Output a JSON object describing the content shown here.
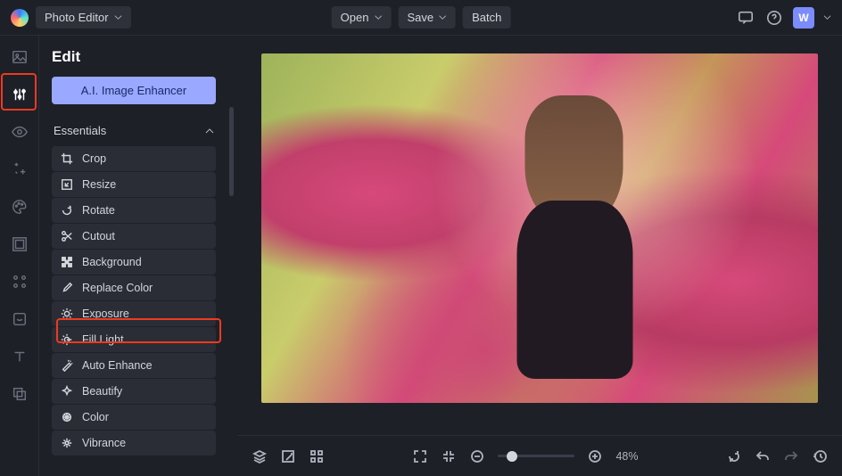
{
  "topbar": {
    "app_name": "Photo Editor",
    "open_label": "Open",
    "save_label": "Save",
    "batch_label": "Batch",
    "avatar_initial": "W"
  },
  "iconrail": {
    "items": [
      {
        "name": "image",
        "active": false
      },
      {
        "name": "adjust",
        "active": true
      },
      {
        "name": "eye",
        "active": false
      },
      {
        "name": "effects",
        "active": false
      },
      {
        "name": "palette",
        "active": false
      },
      {
        "name": "frame",
        "active": false
      },
      {
        "name": "overlay",
        "active": false
      },
      {
        "name": "retouch",
        "active": false
      },
      {
        "name": "text",
        "active": false
      },
      {
        "name": "elements",
        "active": false
      }
    ]
  },
  "sidebar": {
    "title": "Edit",
    "ai_button": "A.I. Image Enhancer",
    "section_label": "Essentials",
    "tools": [
      {
        "label": "Crop",
        "icon": "crop"
      },
      {
        "label": "Resize",
        "icon": "resize"
      },
      {
        "label": "Rotate",
        "icon": "rotate"
      },
      {
        "label": "Cutout",
        "icon": "cutout"
      },
      {
        "label": "Background",
        "icon": "background"
      },
      {
        "label": "Replace Color",
        "icon": "replace-color",
        "highlighted": true
      },
      {
        "label": "Exposure",
        "icon": "exposure"
      },
      {
        "label": "Fill Light",
        "icon": "fill-light"
      },
      {
        "label": "Auto Enhance",
        "icon": "auto-enhance"
      },
      {
        "label": "Beautify",
        "icon": "beautify"
      },
      {
        "label": "Color",
        "icon": "color"
      },
      {
        "label": "Vibrance",
        "icon": "vibrance"
      }
    ]
  },
  "bottombar": {
    "zoom_label": "48%"
  }
}
